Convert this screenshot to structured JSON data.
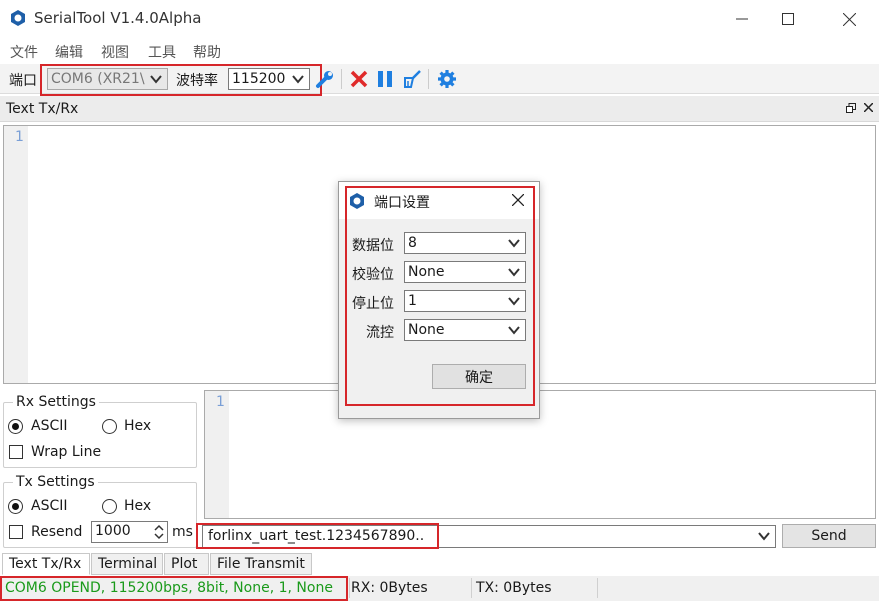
{
  "window": {
    "title": "SerialTool V1.4.0Alpha",
    "minimize_icon": "minimize-icon",
    "maximize_icon": "maximize-icon",
    "close_icon": "close-icon"
  },
  "menu": {
    "items": [
      "文件",
      "编辑",
      "视图",
      "工具",
      "帮助"
    ]
  },
  "toolbar": {
    "port_label": "端口",
    "port_value": "COM6 (XR21\\",
    "baud_label": "波特率",
    "baud_value": "115200",
    "icons": [
      "wrench-icon",
      "disconnect-x-icon",
      "pause-icon",
      "clear-brush-icon",
      "settings-gear-icon"
    ],
    "icon_colors": {
      "blue": "#1f7fe0",
      "red": "#e02a2a"
    }
  },
  "dock": {
    "title": "Text Tx/Rx"
  },
  "rx_editor": {
    "line_number": "1"
  },
  "tx_editor": {
    "line_number": "1"
  },
  "rx_settings": {
    "title": "Rx Settings",
    "ascii_label": "ASCII",
    "hex_label": "Hex",
    "wrap_label": "Wrap Line",
    "selected": "ASCII",
    "wrap_checked": false
  },
  "tx_settings": {
    "title": "Tx Settings",
    "ascii_label": "ASCII",
    "hex_label": "Hex",
    "resend_label": "Resend",
    "resend_interval": "1000",
    "unit": "ms",
    "selected": "ASCII",
    "resend_checked": false
  },
  "send_bar": {
    "input_value": "forlinx_uart_test.1234567890..",
    "send_label": "Send"
  },
  "tabs": [
    "Text Tx/Rx",
    "Terminal",
    "Plot",
    "File Transmit"
  ],
  "status": {
    "connection": "COM6 OPEND, 115200bps, 8bit, None, 1, None",
    "rx": "RX: 0Bytes",
    "tx": "TX: 0Bytes",
    "connection_color": "#1a9a1a"
  },
  "dialog": {
    "title": "端口设置",
    "fields": [
      {
        "label": "数据位",
        "value": "8"
      },
      {
        "label": "校验位",
        "value": "None"
      },
      {
        "label": "停止位",
        "value": "1"
      },
      {
        "label": "流控",
        "value": "None"
      }
    ],
    "ok_label": "确定"
  },
  "highlight_color": "#d6262a"
}
